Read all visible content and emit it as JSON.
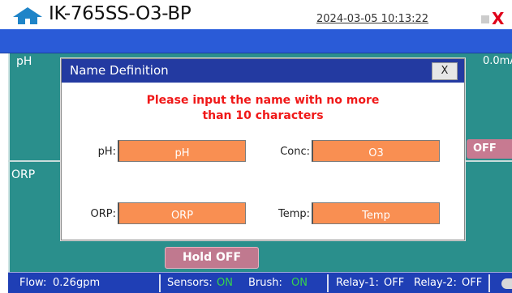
{
  "header": {
    "title": "IK-765SS-O3-BP",
    "datetime": "2024-03-05 10:13:22",
    "close_label": "X"
  },
  "panels": {
    "top_left_label": "pH",
    "bottom_left_label": "ORP",
    "right_reading": "0.0mA",
    "right_button_label": "OFF",
    "hold_button_label": "Hold OFF"
  },
  "statusbar": {
    "flow_label": "Flow:",
    "flow_value": "0.26gpm",
    "sensors_label": "Sensors:",
    "sensors_value": "ON",
    "brush_label": "Brush:",
    "brush_value": "ON",
    "relay1_label": "Relay-1:",
    "relay1_value": "OFF",
    "relay2_label": "Relay-2:",
    "relay2_value": "OFF"
  },
  "dialog": {
    "title": "Name Definition",
    "close_label": "X",
    "message_line1": "Please input the name with no more",
    "message_line2": "than 10 characters",
    "fields": {
      "ph": {
        "label": "pH:",
        "value": "pH"
      },
      "conc": {
        "label": "Conc:",
        "value": "O3"
      },
      "orp": {
        "label": "ORP:",
        "value": "ORP"
      },
      "temp": {
        "label": "Temp:",
        "value": "Temp"
      }
    }
  },
  "colors": {
    "teal_panel": "#2a8f8c",
    "blue_bar": "#2a5bd7",
    "status_bar": "#1f3fb5",
    "dialog_titlebar": "#233aa1",
    "input_orange": "#f98f52",
    "warning_red": "#f01818",
    "on_green": "#37d34c"
  },
  "icons": {
    "home": "home-icon",
    "toggle": "toggle-icon"
  }
}
